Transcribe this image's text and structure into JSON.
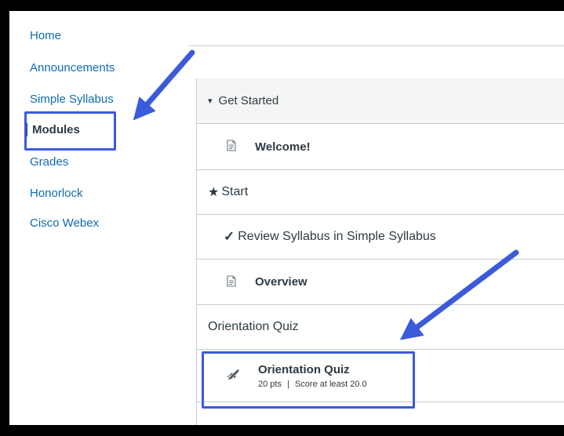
{
  "nav": {
    "items": [
      {
        "label": "Home"
      },
      {
        "label": "Announcements"
      },
      {
        "label": "Simple Syllabus"
      },
      {
        "label": "Modules",
        "active": true
      },
      {
        "label": "Grades"
      },
      {
        "label": "Honorlock"
      },
      {
        "label": "Cisco Webex"
      }
    ]
  },
  "modules": {
    "get_started": {
      "toggle_glyph": "▾",
      "title": "Get Started"
    },
    "welcome": {
      "title": "Welcome!",
      "icon": "document-icon"
    },
    "start": {
      "glyph": "★",
      "title": "Start"
    },
    "review": {
      "glyph": "✓",
      "title": "Review Syllabus in Simple Syllabus"
    },
    "overview": {
      "title": "Overview",
      "icon": "document-icon"
    },
    "orientation_header": {
      "title": "Orientation Quiz"
    },
    "quiz": {
      "title": "Orientation Quiz",
      "points": "20 pts",
      "separator": "|",
      "requirement": "Score at least 20.0",
      "icon": "rocket-quiz-icon"
    }
  },
  "colors": {
    "link": "#0d6bb0",
    "text": "#2d3b45",
    "border": "#c7cdd1",
    "header_bg": "#f5f5f5",
    "annotation": "#3b5bdb"
  }
}
